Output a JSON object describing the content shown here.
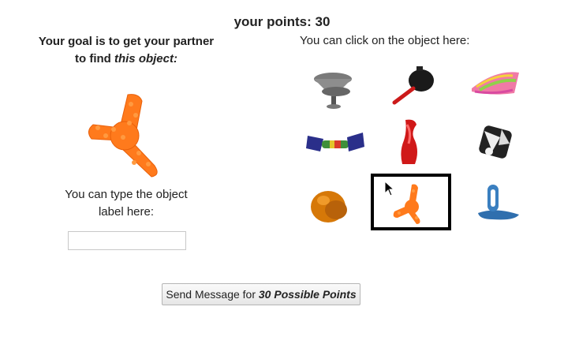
{
  "header": {
    "points_text": "your points: 30"
  },
  "left": {
    "goal_line1": "Your goal is to get your partner",
    "goal_line2_prefix": "to find ",
    "goal_line2_emphasis": "this object:",
    "target_object_icon": "orange-spiky-tripod-toy-icon",
    "type_label_line1": "You can type the object",
    "type_label_line2": "label here:",
    "input_value": "",
    "input_placeholder": ""
  },
  "right": {
    "click_label": "You can click on the object here:",
    "objects": [
      {
        "icon": "gray-cone-stack-icon",
        "selected": false
      },
      {
        "icon": "black-blower-bulb-icon",
        "selected": false
      },
      {
        "icon": "pink-green-feather-comb-icon",
        "selected": false
      },
      {
        "icon": "rainbow-dumbbell-icon",
        "selected": false
      },
      {
        "icon": "red-twisted-vase-icon",
        "selected": false
      },
      {
        "icon": "black-white-cube-icon",
        "selected": false
      },
      {
        "icon": "orange-blob-icon",
        "selected": false
      },
      {
        "icon": "orange-spiky-tripod-toy-icon",
        "selected": true
      },
      {
        "icon": "blue-ring-stand-icon",
        "selected": false
      }
    ]
  },
  "send_button": {
    "prefix": "Send Message for ",
    "emphasis": "30 Possible Points"
  },
  "colors": {
    "target_orange": "#ff7a1c",
    "selection_border": "#000000"
  }
}
